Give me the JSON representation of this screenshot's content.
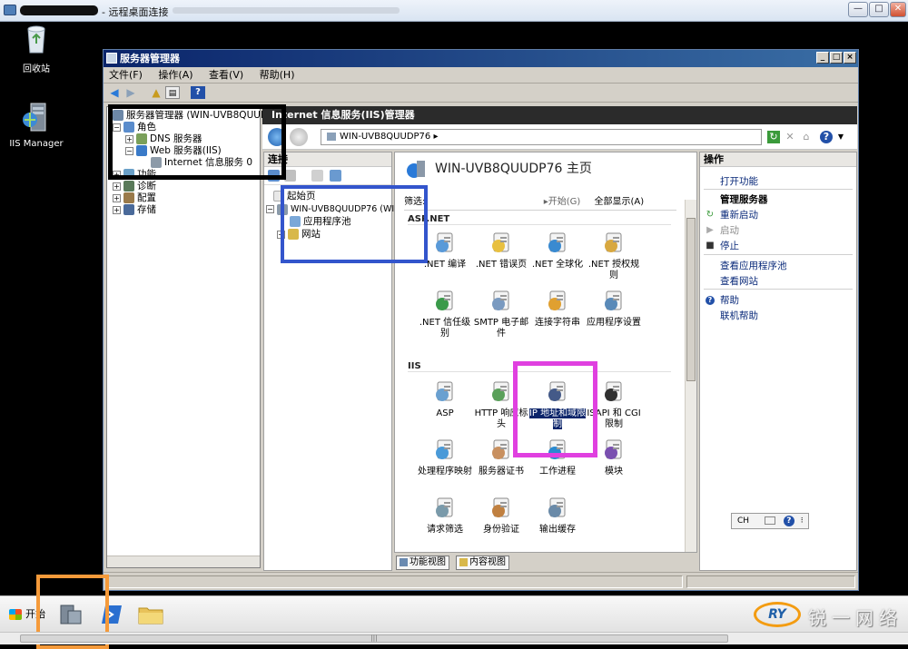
{
  "rdp": {
    "title": "- 远程桌面连接",
    "ctl_min": "—",
    "ctl_max": "□",
    "ctl_close": "✕"
  },
  "desktop": {
    "icons": [
      {
        "label": "回收站"
      },
      {
        "label": "IIS Manager"
      }
    ]
  },
  "server_manager": {
    "title": "服务器管理器",
    "menu": [
      "文件(F)",
      "操作(A)",
      "查看(V)",
      "帮助(H)"
    ],
    "tree": [
      {
        "label": "服务器管理器 (WIN-UVB8QUUDP7",
        "pm": ""
      },
      {
        "label": "角色",
        "pm": "−"
      },
      {
        "label": "DNS 服务器",
        "pm": "+"
      },
      {
        "label": "Web 服务器(IIS)",
        "pm": "−"
      },
      {
        "label": "Internet 信息服务 0",
        "pm": ""
      },
      {
        "label": "功能",
        "pm": "+"
      },
      {
        "label": "诊断",
        "pm": "+"
      },
      {
        "label": "配置",
        "pm": "+"
      },
      {
        "label": "存储",
        "pm": "+"
      }
    ]
  },
  "iis": {
    "header": "Internet 信息服务(IIS)管理器",
    "address": "WIN-UVB8QUUDP76 ▸",
    "connections": {
      "title": "连接",
      "tree": [
        {
          "label": "起始页",
          "pm": ""
        },
        {
          "label": "WIN-UVB8QUUDP76 (WIN",
          "pm": "−"
        },
        {
          "label": "应用程序池",
          "pm": ""
        },
        {
          "label": "网站",
          "pm": "+"
        }
      ]
    },
    "home_title": "WIN-UVB8QUUDP76 主页",
    "filter": {
      "label": "筛选:",
      "start": "▸开始(G)",
      "show_all": "全部显示(A)"
    },
    "groups": [
      {
        "name": "ASP.NET"
      },
      {
        "name": "IIS"
      }
    ],
    "features": [
      {
        "label": ".NET 编译"
      },
      {
        "label": ".NET 错误页"
      },
      {
        "label": ".NET 全球化"
      },
      {
        "label": ".NET 授权规则"
      },
      {
        "label": ".NET 信任级别"
      },
      {
        "label": "SMTP 电子邮件"
      },
      {
        "label": "连接字符串"
      },
      {
        "label": "应用程序设置"
      },
      {
        "label": "ASP"
      },
      {
        "label": "HTTP 响应标头"
      },
      {
        "label": "IP 地址和域限制"
      },
      {
        "label": "ISAPI 和 CGI 限制"
      },
      {
        "label": "处理程序映射"
      },
      {
        "label": "服务器证书"
      },
      {
        "label": "工作进程"
      },
      {
        "label": "模块"
      },
      {
        "label": "请求筛选"
      },
      {
        "label": "身份验证"
      },
      {
        "label": "输出缓存"
      }
    ],
    "view_tabs": [
      "功能视图",
      "内容视图"
    ],
    "actions": {
      "title": "操作",
      "items": [
        {
          "label": "打开功能"
        },
        {
          "label": "管理服务器"
        },
        {
          "label": "重新启动"
        },
        {
          "label": "启动"
        },
        {
          "label": "停止"
        },
        {
          "label": "查看应用程序池"
        },
        {
          "label": "查看网站"
        },
        {
          "label": "帮助"
        },
        {
          "label": "联机帮助"
        }
      ],
      "lang": "CH"
    }
  },
  "taskbar": {
    "start": "开始",
    "brand": "锐一网络"
  },
  "colors": {
    "annot_black": "#000000",
    "annot_blue": "#3355cc",
    "annot_magenta": "#e040e0",
    "annot_orange": "#f59a3a"
  }
}
